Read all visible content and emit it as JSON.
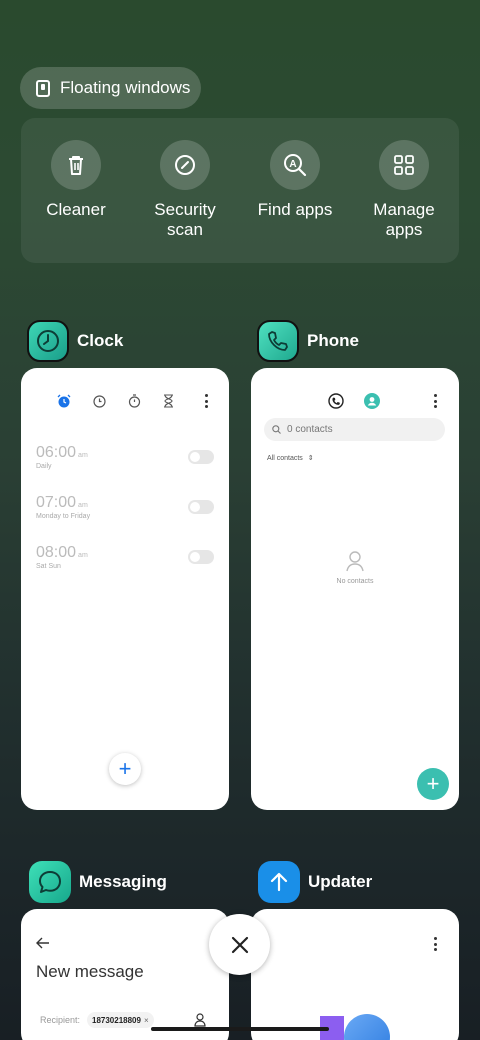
{
  "floating": {
    "label": "Floating windows"
  },
  "quick_actions": [
    {
      "icon": "trash-icon",
      "label": "Cleaner"
    },
    {
      "icon": "shield-scan-icon",
      "label": "Security\nscan"
    },
    {
      "icon": "find-apps-icon",
      "label": "Find apps"
    },
    {
      "icon": "grid-icon",
      "label": "Manage\napps"
    }
  ],
  "apps": {
    "clock": {
      "name": "Clock",
      "alarms": [
        {
          "time": "06:00",
          "ampm": "am",
          "repeat": "Daily"
        },
        {
          "time": "07:00",
          "ampm": "am",
          "repeat": "Monday to Friday"
        },
        {
          "time": "08:00",
          "ampm": "am",
          "repeat": "Sat Sun"
        }
      ],
      "fab": "+"
    },
    "phone": {
      "name": "Phone",
      "search_placeholder": "0 contacts",
      "filter": "All contacts",
      "empty": "No contacts",
      "fab": "+"
    },
    "messaging": {
      "name": "Messaging",
      "title": "New message",
      "recipient_label": "Recipient:",
      "recipient_chip": "18730218809",
      "chip_remove": "×"
    },
    "updater": {
      "name": "Updater"
    }
  },
  "colors": {
    "accent_blue": "#1a73e8",
    "teal": "#3bbfb0",
    "clock_icon": "#2bb59a",
    "updater_icon": "#1a8fe8"
  }
}
